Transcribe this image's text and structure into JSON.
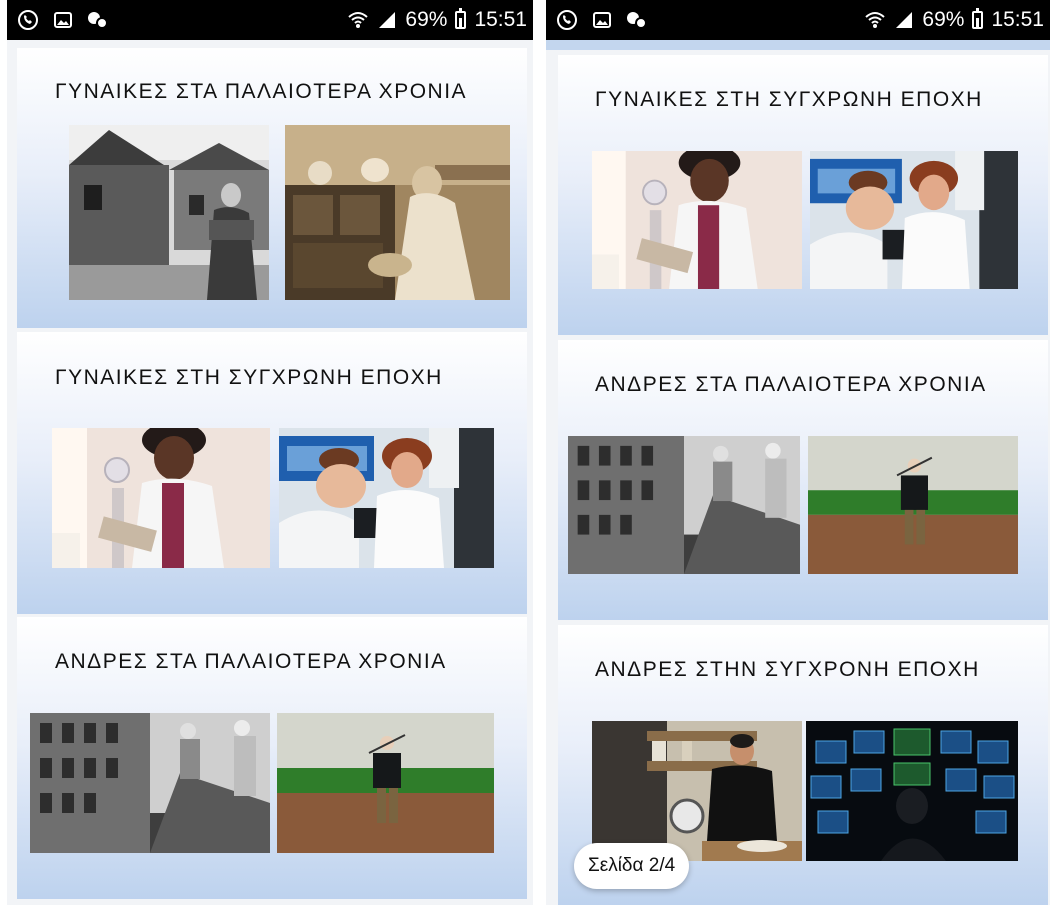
{
  "status_bar": {
    "battery": "69%",
    "time": "15:51",
    "left_icons": [
      "viber-icon",
      "image-icon",
      "network-sharing-icon"
    ]
  },
  "sections": {
    "women_past": "ΓΥΝΑΙΚΕΣ ΣΤΑ ΠΑΛΑΙΟΤΕΡΑ ΧΡΟΝΙΑ",
    "women_modern": "ΓΥΝΑΙΚΕΣ ΣΤΗ ΣΥΓΧΡΩΝΗ ΕΠΟΧΗ",
    "men_past": "ΑΝΔΡΕΣ ΣΤΑ ΠΑΛΑΙΟΤΕΡΑ ΧΡΟΝΙΑ",
    "men_modern": "ΑΝΔΡΕΣ ΣΤΗΝ ΣΥΓΧΡΟΝΗ ΕΠΟΧΗ"
  },
  "page_indicator": "Σελίδα 2/4",
  "colors": {
    "card_top": "#ffffff",
    "card_bottom": "#bdd2ee",
    "status_bar": "#000000"
  }
}
